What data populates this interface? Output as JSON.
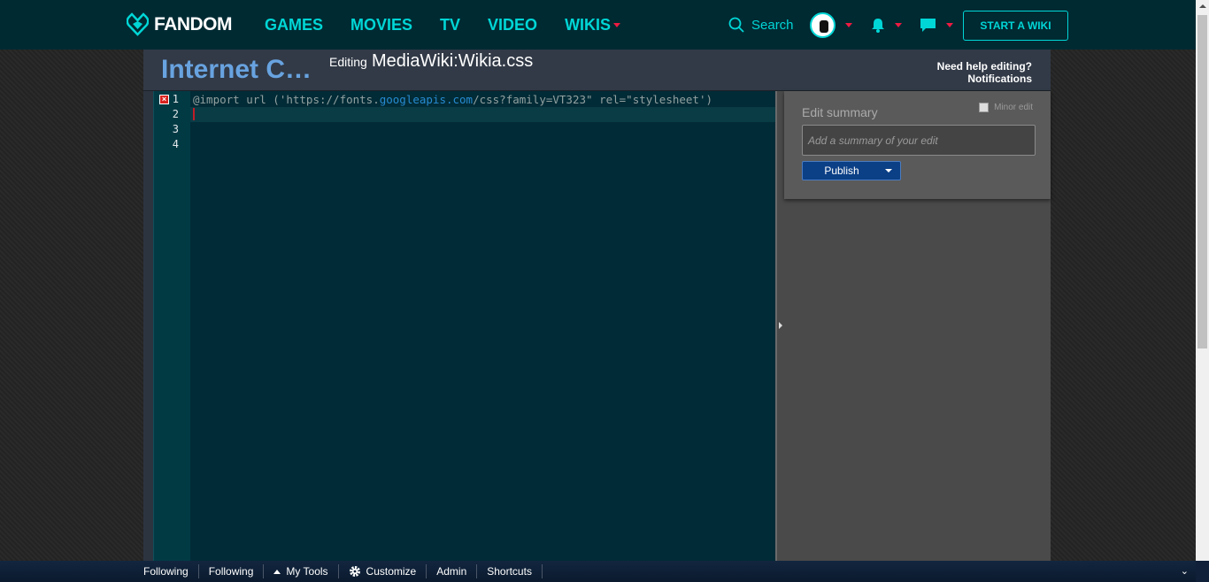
{
  "topnav": {
    "logo_text": "FANDOM",
    "links": [
      {
        "label": "GAMES"
      },
      {
        "label": "MOVIES"
      },
      {
        "label": "TV"
      },
      {
        "label": "VIDEO"
      },
      {
        "label": "WIKIS"
      }
    ],
    "search_label": "Search",
    "start_wiki_label": "START A WIKI"
  },
  "header": {
    "wiki_name": "Internet C…",
    "editing_label": "Editing",
    "page_title": "MediaWiki:Wikia.css",
    "help_line1": "Need help editing?",
    "help_line2": "Notifications"
  },
  "editor": {
    "line_numbers": [
      "1",
      "2",
      "3",
      "4"
    ],
    "lines": [
      {
        "pre": "@import url ('https://fonts.",
        "hl": "googleapis.com",
        "post": "/css?family=VT323\" rel=\"stylesheet')"
      },
      {
        "pre": "",
        "hl": "",
        "post": ""
      },
      {
        "pre": "",
        "hl": "",
        "post": ""
      },
      {
        "pre": "",
        "hl": "",
        "post": ""
      }
    ]
  },
  "sidebar": {
    "summary_label": "Edit summary",
    "minor_edit_label": "Minor edit",
    "summary_placeholder": "Add a summary of your edit",
    "publish_label": "Publish"
  },
  "bottombar": {
    "items": [
      "Following",
      "Following",
      "My Tools",
      "Customize",
      "Admin",
      "Shortcuts"
    ]
  },
  "colors": {
    "nav_bg": "#002a32",
    "accent": "#00d6d6",
    "wiki_name": "#68a3e0",
    "editor_bg": "#012b36",
    "publish_bg": "#0b3f86"
  }
}
